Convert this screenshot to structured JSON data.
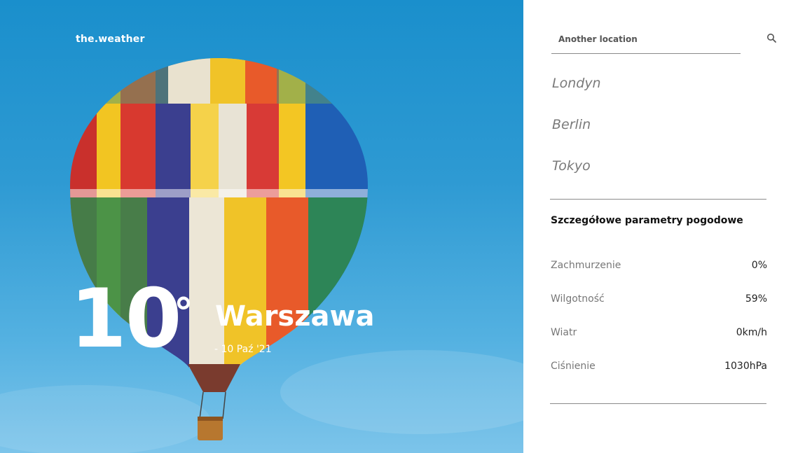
{
  "brand": "the.weather",
  "current": {
    "temperature": "10",
    "degree_symbol": "°",
    "city": "Warszawa",
    "date": "- 10 Paź '21"
  },
  "search": {
    "placeholder": "Another location",
    "value": "",
    "icon": "search-icon"
  },
  "locations": [
    "Londyn",
    "Berlin",
    "Tokyo"
  ],
  "details": {
    "title": "Szczegółowe parametry pogodowe",
    "rows": [
      {
        "label": "Zachmurzenie",
        "value": "0%"
      },
      {
        "label": "Wilgotność",
        "value": "59%"
      },
      {
        "label": "Wiatr",
        "value": "0km/h"
      },
      {
        "label": "Ciśnienie",
        "value": "1030hPa"
      }
    ]
  },
  "colors": {
    "sky": "#2e9ad3",
    "panel_bg": "#ffffff",
    "text_muted": "#7a7a7a"
  }
}
